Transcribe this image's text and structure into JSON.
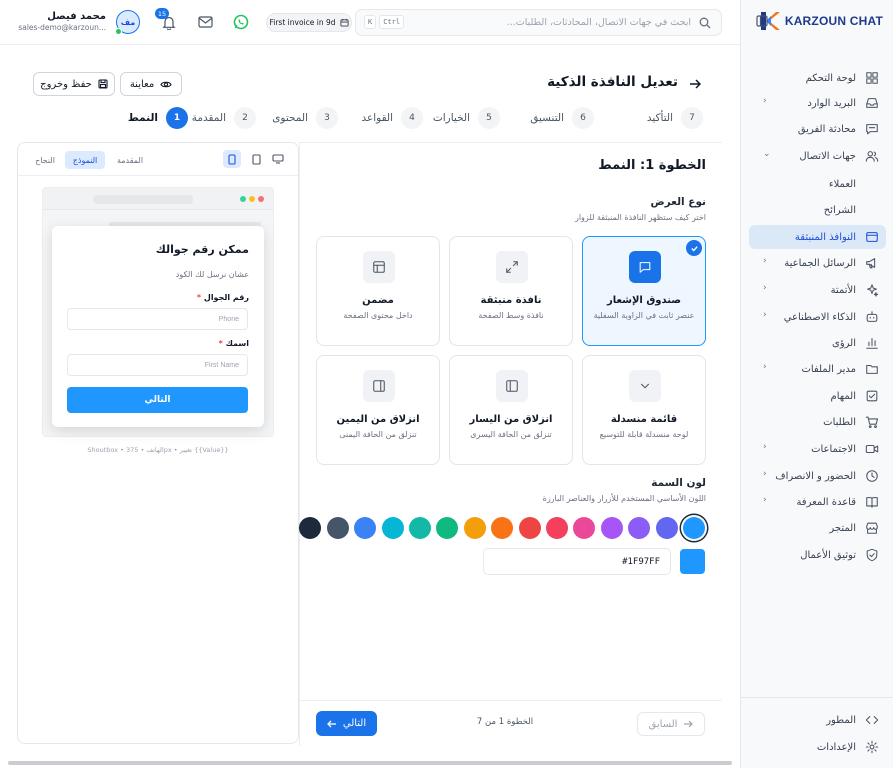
{
  "brand": {
    "name": "KARZOUN CHAT"
  },
  "topbar": {
    "search_placeholder": "ابحث في جهات الاتصال، المحادثات، الطلبات...",
    "kbd1": "K",
    "kbd2": "Ctrl",
    "invoice_pill": "First invoice in 9d",
    "notification_count": "15",
    "user_name": "محمد فيصل",
    "user_email": "sales-demo@karzoun...",
    "avatar_initials": "مف"
  },
  "sidebar": {
    "items": [
      {
        "label": "لوحة التحكم",
        "icon": "dashboard-icon"
      },
      {
        "label": "البريد الوارد",
        "icon": "inbox-icon"
      },
      {
        "label": "محادثة الفريق",
        "icon": "team-chat-icon"
      },
      {
        "label": "جهات الاتصال",
        "icon": "contacts-icon"
      },
      {
        "label": "العملاء"
      },
      {
        "label": "الشرائح"
      },
      {
        "label": "النوافذ المنبثقة",
        "icon": "popup-icon"
      },
      {
        "label": "الرسائل الجماعية",
        "icon": "megaphone-icon"
      },
      {
        "label": "الأتمتة",
        "icon": "sparkles-icon"
      },
      {
        "label": "الذكاء الاصطناعي",
        "icon": "bot-icon"
      },
      {
        "label": "الرؤى",
        "icon": "chart-icon"
      },
      {
        "label": "مدير الملفات",
        "icon": "folder-icon"
      },
      {
        "label": "المهام",
        "icon": "task-icon"
      },
      {
        "label": "الطلبات",
        "icon": "cart-icon"
      },
      {
        "label": "الاجتماعات",
        "icon": "video-icon"
      },
      {
        "label": "الحضور و الانصراف",
        "icon": "clock-icon"
      },
      {
        "label": "قاعدة المعرفة",
        "icon": "book-icon"
      },
      {
        "label": "المتجر",
        "icon": "store-icon"
      },
      {
        "label": "توثيق الأعمال",
        "icon": "shield-icon"
      }
    ],
    "bottom": [
      {
        "label": "المطور",
        "icon": "code-icon"
      },
      {
        "label": "الإعدادات",
        "icon": "gear-icon"
      }
    ]
  },
  "header": {
    "title": "تعديل النافذة الذكية",
    "preview_label": "معاينة",
    "save_label": "حفظ وخروج"
  },
  "steps": [
    {
      "num": "1",
      "label": "النمط"
    },
    {
      "num": "2",
      "label": "المقدمة"
    },
    {
      "num": "3",
      "label": "المحتوى"
    },
    {
      "num": "4",
      "label": "القواعد"
    },
    {
      "num": "5",
      "label": "الخيارات"
    },
    {
      "num": "6",
      "label": "التنسيق"
    },
    {
      "num": "7",
      "label": "التأكيد"
    }
  ],
  "main": {
    "step_title": "الخطوة 1: النمط",
    "display_type_title": "نوع العرض",
    "display_type_desc": "اختر كيف ستظهر النافذة المنبثقة للزوار",
    "cards": [
      {
        "title": "صندوق الإشعار",
        "desc": "عنصر ثابت في الزاوية السفلية",
        "icon": "message-square-icon",
        "selected": true
      },
      {
        "title": "نافذة منبثقة",
        "desc": "نافذة وسط الصفحة",
        "icon": "expand-icon",
        "selected": false
      },
      {
        "title": "مضمن",
        "desc": "داخل محتوى الصفحة",
        "icon": "layout-icon",
        "selected": false
      },
      {
        "title": "قائمة منسدلة",
        "desc": "لوحة منسدلة قابلة للتوسيع",
        "icon": "chevron-down-icon",
        "selected": false
      },
      {
        "title": "انزلاق من اليسار",
        "desc": "تنزلق من الحافة اليسرى",
        "icon": "panel-left-icon",
        "selected": false
      },
      {
        "title": "انزلاق من اليمين",
        "desc": "تنزلق من الحافة اليمنى",
        "icon": "panel-right-icon",
        "selected": false
      }
    ],
    "color_title": "لون السمة",
    "color_desc": "اللون الأساسي المستخدم للأزرار والعناصر البارزة",
    "swatches": [
      "#1f97ff",
      "#6366f1",
      "#8b5cf6",
      "#a855f7",
      "#ec4899",
      "#f43f5e",
      "#ef4444",
      "#f97316",
      "#f59e0b",
      "#10b981",
      "#14b8a6",
      "#06b6d4",
      "#3b82f6",
      "#475569",
      "#1e293b"
    ],
    "hex_value": "#1F97FF",
    "selected_color": "#1f97ff"
  },
  "footer": {
    "prev_label": "السابق",
    "step_count": "الخطوة 1 من 7",
    "next_label": "التالي"
  },
  "preview": {
    "tabs": [
      "المقدمة",
      "النموذج",
      "النجاح"
    ],
    "active_tab": "النموذج",
    "popup_title": "ممكن رقم جوالك",
    "popup_subtitle": "عشان نرسل لك الكود",
    "phone_label": "رقم الجوال",
    "phone_placeholder": "Phone",
    "name_label": "اسمك",
    "name_placeholder": "First Name",
    "next_button": "التالي",
    "caption": "Shoutbox • الهاتف • 375px • تغيير {{Value}}"
  }
}
